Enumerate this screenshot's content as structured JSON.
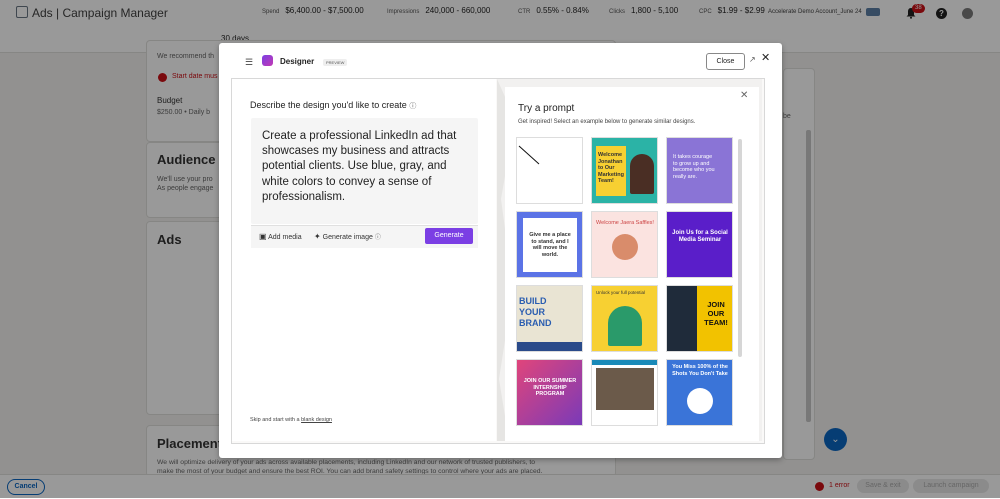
{
  "app": {
    "title": "Ads | Campaign Manager"
  },
  "header": {
    "account": "Accelerate Demo Account_June 24",
    "notification_count": "38",
    "help": "?"
  },
  "stats": {
    "period": "30 days",
    "spend_label": "Spend",
    "spend_value": "$6,400.00 - $7,500.00",
    "impressions_label": "Impressions",
    "impressions_value": "240,000 - 660,000",
    "ctr_label": "CTR",
    "ctr_value": "0.55% - 0.84%",
    "clicks_label": "Clicks",
    "clicks_value": "1,800 - 5,100",
    "cpc_label": "CPC",
    "cpc_value": "$1.99 - $2.99"
  },
  "background": {
    "recommend": "We recommend th",
    "start_date_error": "Start date mus",
    "budget_label": "Budget",
    "budget_value": "$250.00 • Daily b",
    "audience_title": "Audience s",
    "audience_desc_1": "We'll use your pro",
    "audience_desc_2": "As people engage",
    "ads_title": "Ads",
    "side_text": "be",
    "placements_title": "Placements",
    "placements_desc_1": "We will optimize delivery of your ads across available placements, including LinkedIn and our network of trusted publishers, to",
    "placements_desc_2": "make the most of your budget and ensure the best ROI. You can add brand safety settings to control where your ads are placed."
  },
  "bottom": {
    "cancel": "Cancel",
    "errors": "1 error",
    "save_exit": "Save & exit",
    "launch": "Launch campaign"
  },
  "modal": {
    "close_label": "Close",
    "designer_title": "Designer",
    "preview_badge": "PREVIEW",
    "describe_label": "Describe the design you'd like to create",
    "prompt_text": "Create a professional LinkedIn ad that showcases my business and attracts potential clients. Use blue, gray, and white colors to convey a sense of professionalism.",
    "add_media": "Add media",
    "generate_image": "Generate image",
    "generate": "Generate",
    "skip_prefix": "Skip and start with a ",
    "skip_link": "blank design",
    "try_title": "Try a prompt",
    "try_sub": "Get inspired! Select an example below to generate similar designs.",
    "thumbnails": [
      {
        "text": ""
      },
      {
        "text": "Welcome Jonathan to Our Marketing Team!"
      },
      {
        "text": "It takes courage to grow up and become who you really are."
      },
      {
        "text": "Give me a place to stand, and I will move the world."
      },
      {
        "text": "Welcome Jaera Saffles!"
      },
      {
        "text": "Join Us for a Social Media Seminar"
      },
      {
        "text": "BUILD YOUR BRAND"
      },
      {
        "text": "Unlock your full potential"
      },
      {
        "text": "JOIN OUR TEAM!"
      },
      {
        "text": "JOIN OUR SUMMER INTERNSHIP PROGRAM"
      },
      {
        "text": ""
      },
      {
        "text": "You Miss 100% of the Shots You Don't Take"
      }
    ]
  },
  "colors": {
    "accent": "#0a66c2",
    "designer_purple": "#7b3fe4",
    "error": "#cc1016"
  }
}
